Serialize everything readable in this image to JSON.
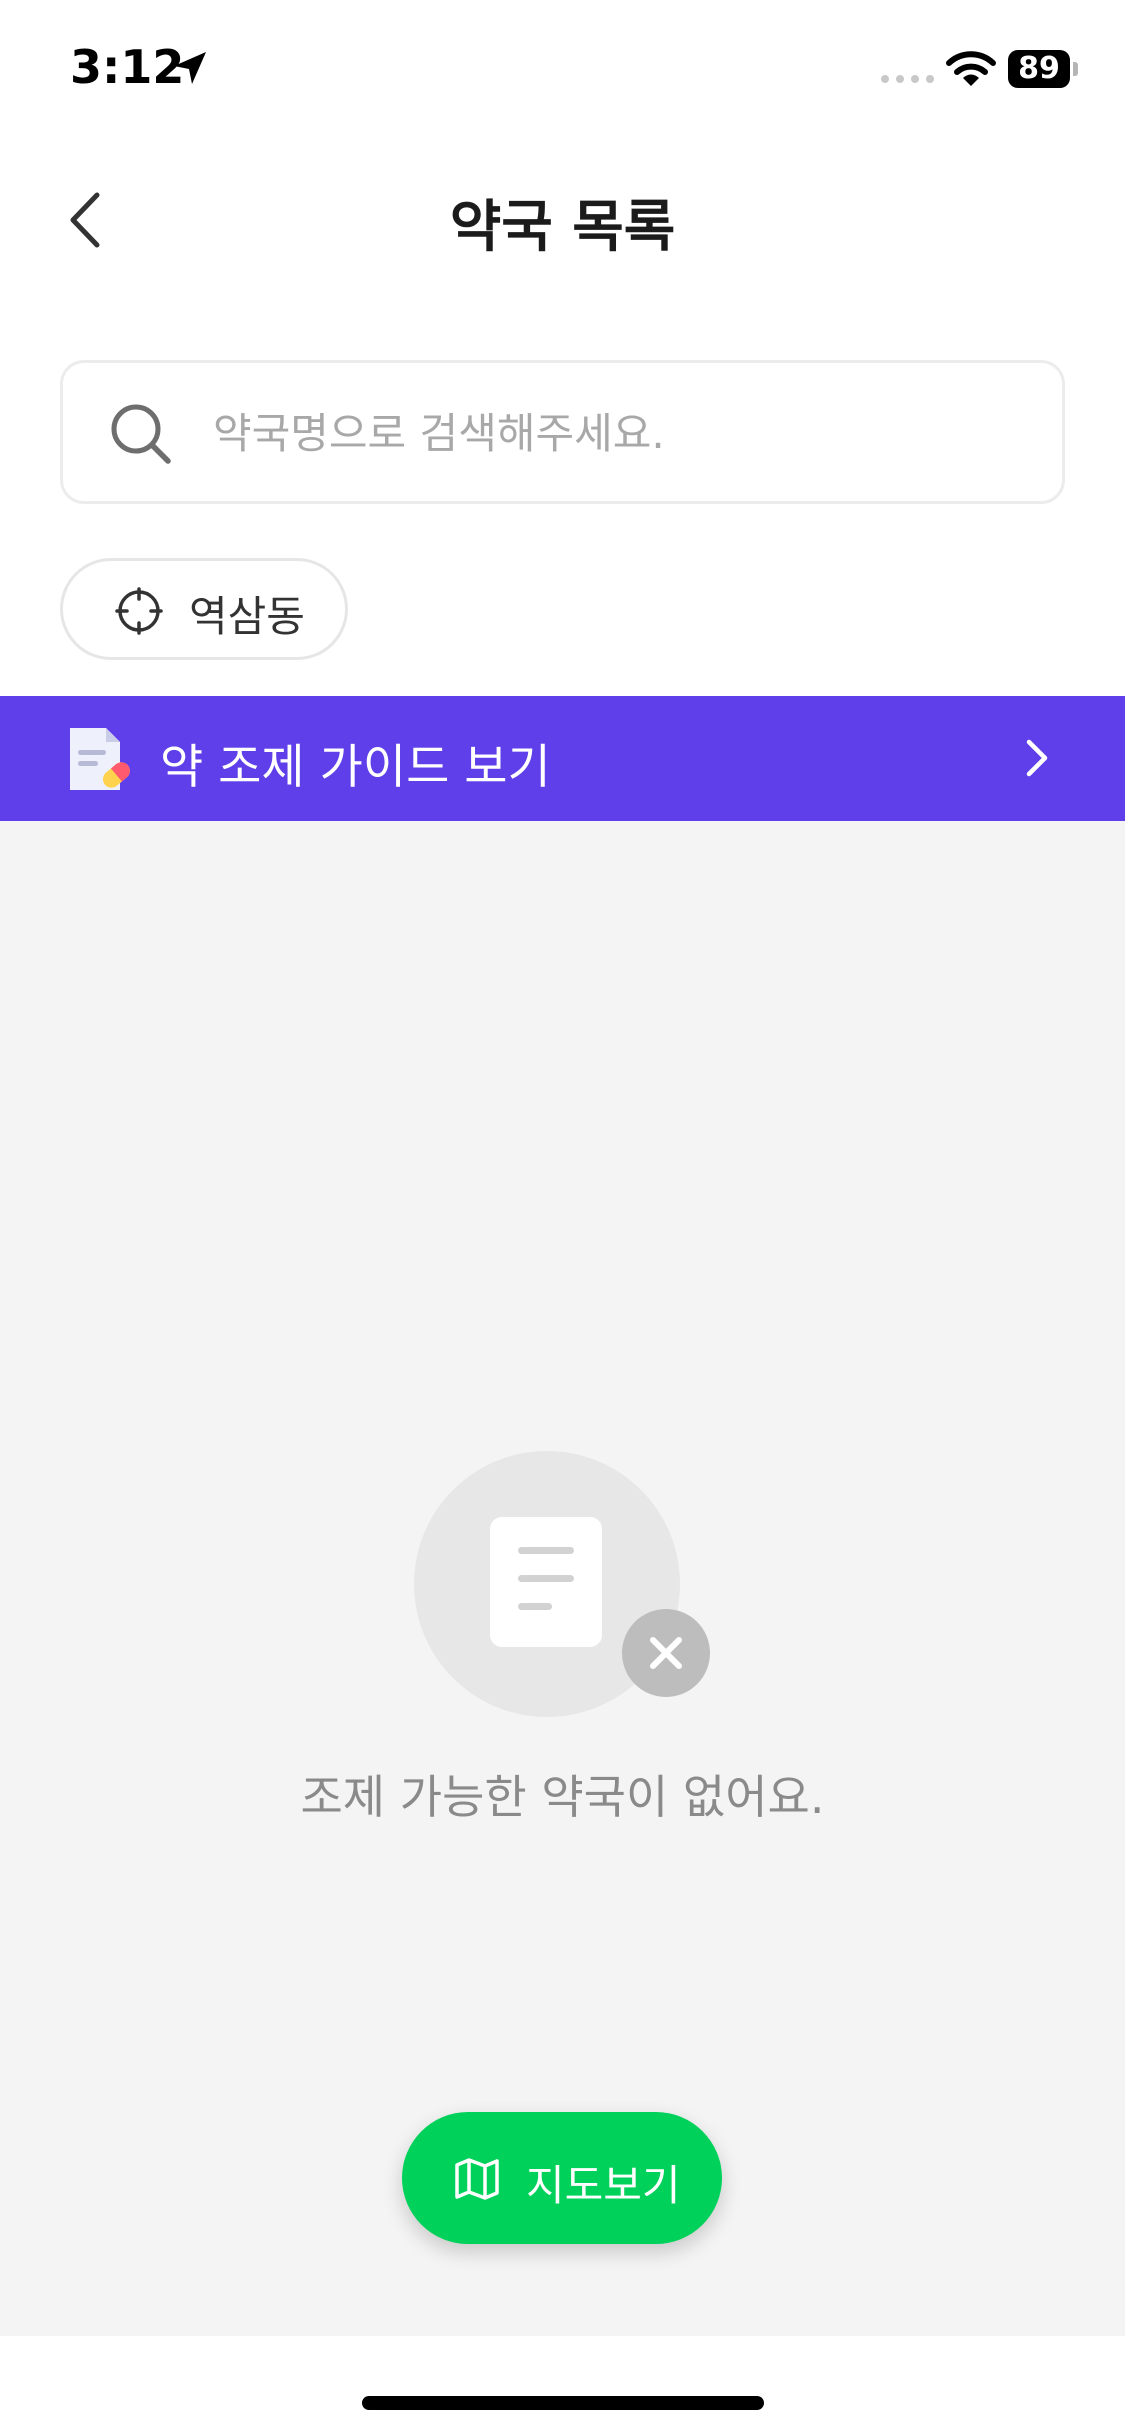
{
  "status_bar": {
    "time": "3:12",
    "battery": "89",
    "icons": [
      "location-arrow-icon",
      "signal-icon",
      "wifi-icon",
      "battery-icon"
    ]
  },
  "header": {
    "title": "약국 목록",
    "back_icon": "chevron-left-icon"
  },
  "search": {
    "placeholder": "약국명으로 검색해주세요.",
    "value": "",
    "icon": "search-icon"
  },
  "location_chip": {
    "label": "역삼동",
    "icon": "crosshair-icon"
  },
  "guide_banner": {
    "label": "약 조제 가이드 보기",
    "icon": "document-pill-icon",
    "chevron": "chevron-right-icon",
    "color": "#5e3fe9"
  },
  "empty_state": {
    "message": "조제 가능한 약국이 없어요.",
    "icon": "document-icon",
    "badge_icon": "close-icon"
  },
  "map_button": {
    "label": "지도보기",
    "icon": "map-icon",
    "color": "#00d15a"
  },
  "colors": {
    "accent_purple": "#5e3fe9",
    "accent_green": "#00d15a",
    "background_gray": "#f4f4f4"
  }
}
